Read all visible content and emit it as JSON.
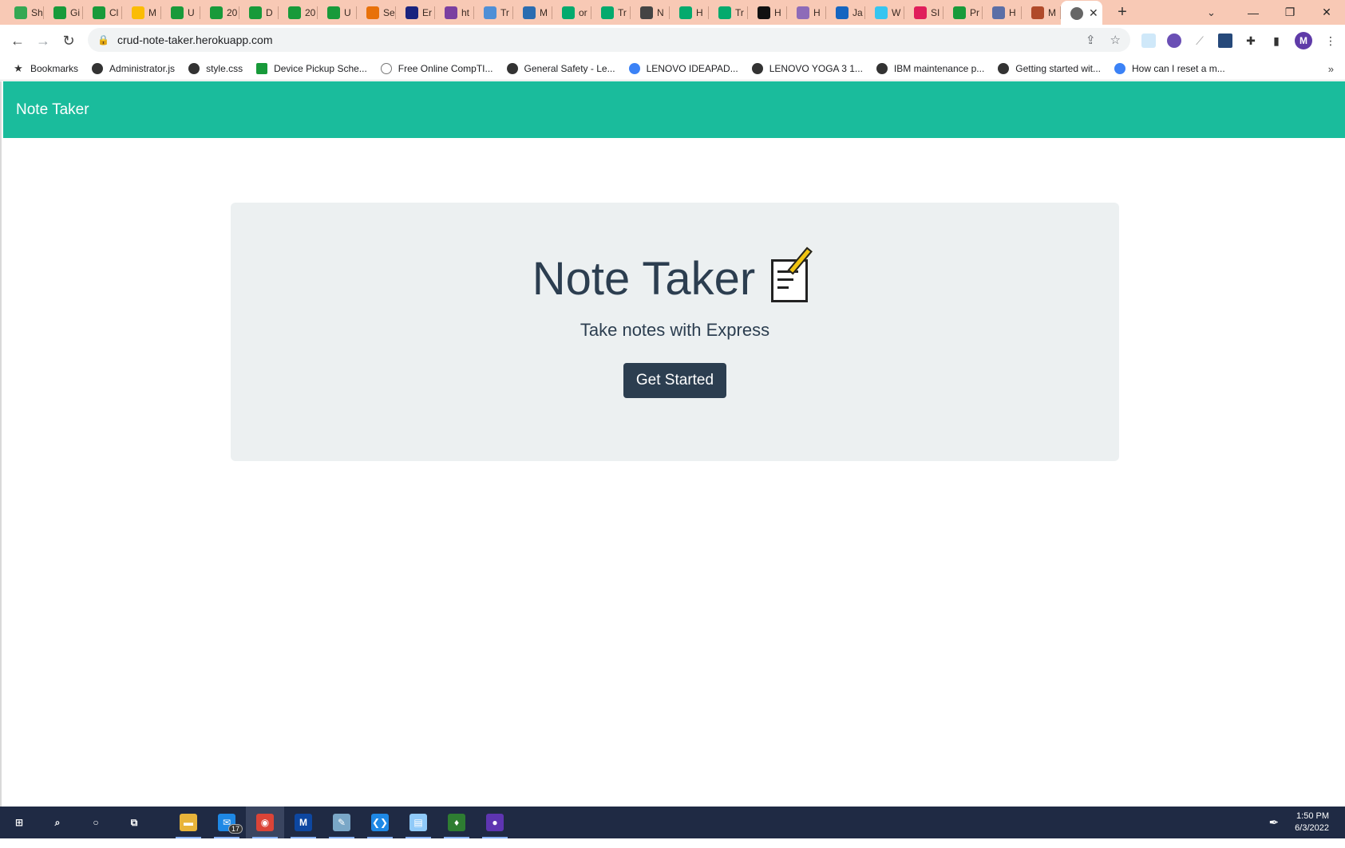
{
  "browser": {
    "tabs": [
      {
        "abbr": "Sh",
        "icon": "google-drive-icon",
        "color": "#34a853"
      },
      {
        "abbr": "Gi",
        "icon": "sheets-icon",
        "color": "#189a3a"
      },
      {
        "abbr": "Cl",
        "icon": "sheets-icon",
        "color": "#189a3a"
      },
      {
        "abbr": "M",
        "icon": "google-drive-icon",
        "color": "#fbbc04"
      },
      {
        "abbr": "U",
        "icon": "sheets-icon",
        "color": "#189a3a"
      },
      {
        "abbr": "20",
        "icon": "sheets-icon",
        "color": "#189a3a"
      },
      {
        "abbr": "D",
        "icon": "sheets-icon",
        "color": "#189a3a"
      },
      {
        "abbr": "20",
        "icon": "sheets-icon",
        "color": "#189a3a"
      },
      {
        "abbr": "U",
        "icon": "sheets-icon",
        "color": "#189a3a"
      },
      {
        "abbr": "Se",
        "icon": "pin-icon",
        "color": "#e8710a"
      },
      {
        "abbr": "Er",
        "icon": "stripes-icon",
        "color": "#1a237e"
      },
      {
        "abbr": "ht",
        "icon": "link-icon",
        "color": "#7b3fa0"
      },
      {
        "abbr": "Tr",
        "icon": "ms-icon",
        "color": "#4f8fd6"
      },
      {
        "abbr": "M",
        "icon": "cube-icon",
        "color": "#2b6cb0"
      },
      {
        "abbr": "or",
        "icon": "w3-icon",
        "color": "#04aa6d"
      },
      {
        "abbr": "Tr",
        "icon": "w3-icon",
        "color": "#04aa6d"
      },
      {
        "abbr": "N",
        "icon": "globe-icon",
        "color": "#444444"
      },
      {
        "abbr": "H",
        "icon": "w3-icon",
        "color": "#04aa6d"
      },
      {
        "abbr": "Tr",
        "icon": "w3-icon",
        "color": "#04aa6d"
      },
      {
        "abbr": "H",
        "icon": "m-icon",
        "color": "#111111"
      },
      {
        "abbr": "H",
        "icon": "h-icon",
        "color": "#8e6bb8"
      },
      {
        "abbr": "Ja",
        "icon": "circle-icon",
        "color": "#1565c0"
      },
      {
        "abbr": "W",
        "icon": "slack-icon",
        "color": "#36c5f0"
      },
      {
        "abbr": "SI",
        "icon": "slack-icon",
        "color": "#e01e5a"
      },
      {
        "abbr": "Pr",
        "icon": "sheets-icon",
        "color": "#189a3a"
      },
      {
        "abbr": "H",
        "icon": "globe-icon",
        "color": "#5b6ea6"
      },
      {
        "abbr": "M",
        "icon": "image-icon",
        "color": "#b04a2a"
      }
    ],
    "active_tab_icon": "globe-icon",
    "new_tab_label": "+",
    "tab_search_label": "⌄",
    "window": {
      "minimize": "—",
      "restore": "❐",
      "close": "✕"
    },
    "address": {
      "url": "crud-note-taker.herokuapp.com"
    },
    "nav": {
      "back": "←",
      "forward": "→",
      "reload": "↻"
    },
    "bookmarks": [
      {
        "label": "Bookmarks",
        "icon": "star-icon",
        "style": "star"
      },
      {
        "label": "Administrator.js",
        "icon": "globe-icon",
        "style": ""
      },
      {
        "label": "style.css",
        "icon": "globe-icon",
        "style": ""
      },
      {
        "label": "Device Pickup Sche...",
        "icon": "sheets-icon",
        "style": "green"
      },
      {
        "label": "Free Online CompTI...",
        "icon": "loading-icon",
        "style": "ghost"
      },
      {
        "label": "General Safety - Le...",
        "icon": "globe-icon",
        "style": ""
      },
      {
        "label": "LENOVO IDEAPAD...",
        "icon": "mail-icon",
        "style": "blue"
      },
      {
        "label": "LENOVO YOGA 3 1...",
        "icon": "globe-icon",
        "style": ""
      },
      {
        "label": "IBM maintenance p...",
        "icon": "globe-icon",
        "style": ""
      },
      {
        "label": "Getting started wit...",
        "icon": "globe-icon",
        "style": ""
      },
      {
        "label": "How can I reset a m...",
        "icon": "x-icon",
        "style": "blue"
      }
    ],
    "bookmarks_more": "»"
  },
  "app": {
    "brand": "Note Taker",
    "hero_title": "Note Taker",
    "hero_icon": "memo-icon",
    "subtitle": "Take notes with Express",
    "cta_label": "Get Started",
    "colors": {
      "navbar": "#1abc9c",
      "jumbotron": "#ecf0f1",
      "text": "#2c3e50",
      "button": "#2c3e50"
    }
  },
  "taskbar": {
    "apps": [
      {
        "name": "start-button",
        "icon": "windows-icon",
        "glyph": "⊞",
        "color": "transparent",
        "open": false
      },
      {
        "name": "search-button",
        "icon": "search-icon",
        "glyph": "⌕",
        "color": "transparent",
        "open": false
      },
      {
        "name": "cortana-button",
        "icon": "circle-icon",
        "glyph": "○",
        "color": "transparent",
        "open": false
      },
      {
        "name": "task-view-button",
        "icon": "task-view-icon",
        "glyph": "⧉",
        "color": "transparent",
        "open": false
      },
      {
        "name": "file-explorer-button",
        "icon": "folder-icon",
        "glyph": "▬",
        "color": "#e8b43a",
        "open": true
      },
      {
        "name": "mail-button",
        "icon": "mail-icon",
        "glyph": "✉",
        "color": "#1e88e5",
        "open": true,
        "badge": "17"
      },
      {
        "name": "chrome-button",
        "icon": "chrome-icon",
        "glyph": "◉",
        "color": "#db4437",
        "open": true,
        "active": true
      },
      {
        "name": "app-m-button",
        "icon": "m-app-icon",
        "glyph": "M",
        "color": "#0d47a1",
        "open": true
      },
      {
        "name": "paint-button",
        "icon": "paint-icon",
        "glyph": "✎",
        "color": "#7aa7c7",
        "open": true
      },
      {
        "name": "vscode-button",
        "icon": "vscode-icon",
        "glyph": "❮❯",
        "color": "#1e88e5",
        "open": true
      },
      {
        "name": "notepad-button",
        "icon": "notepad-icon",
        "glyph": "▤",
        "color": "#90caf9",
        "open": true
      },
      {
        "name": "mongodb-button",
        "icon": "leaf-icon",
        "glyph": "♦",
        "color": "#2e7d32",
        "open": true
      },
      {
        "name": "app-purple-button",
        "icon": "purple-circle-icon",
        "glyph": "●",
        "color": "#5e35b1",
        "open": true
      }
    ],
    "tray_icon": "pen-icon",
    "time": "1:50 PM",
    "date": "6/3/2022"
  }
}
